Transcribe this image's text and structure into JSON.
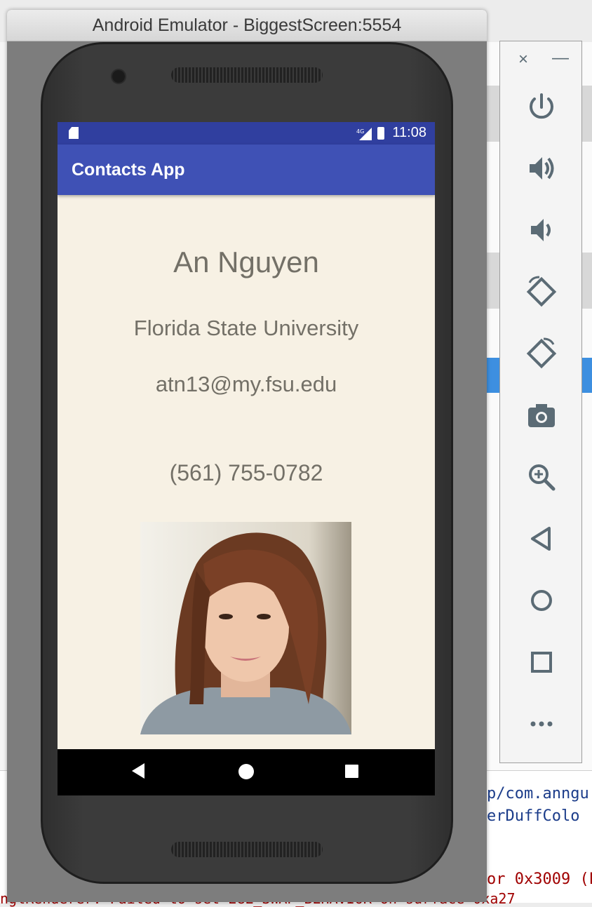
{
  "emulator": {
    "title": "Android Emulator - BiggestScreen:5554"
  },
  "status_bar": {
    "network": "4G",
    "time": "11:08"
  },
  "app": {
    "title": "Contacts App"
  },
  "contact": {
    "name": "An Nguyen",
    "school": "Florida State University",
    "email": "atn13@my.fsu.edu",
    "phone": "(561) 755-0782",
    "photo_icon": "contact-photo"
  },
  "nav": {
    "back_icon": "back-triangle",
    "home_icon": "home-circle",
    "recents_icon": "recents-square"
  },
  "side_panel": {
    "close_label": "×",
    "minimize_label": "—",
    "controls": [
      "power-icon",
      "volume-up-icon",
      "volume-down-icon",
      "rotate-left-icon",
      "rotate-right-icon",
      "camera-icon",
      "zoom-icon",
      "back-icon",
      "home-icon",
      "overview-icon",
      "more-icon"
    ]
  },
  "background": {
    "bottom_lines": [
      "p/com.anngu",
      "erDuffColo",
      "or 0x3009 (E",
      "nglRenderer: Failed to set EGL_SWAP_BEHAVIOR on surface 0xa27"
    ]
  }
}
